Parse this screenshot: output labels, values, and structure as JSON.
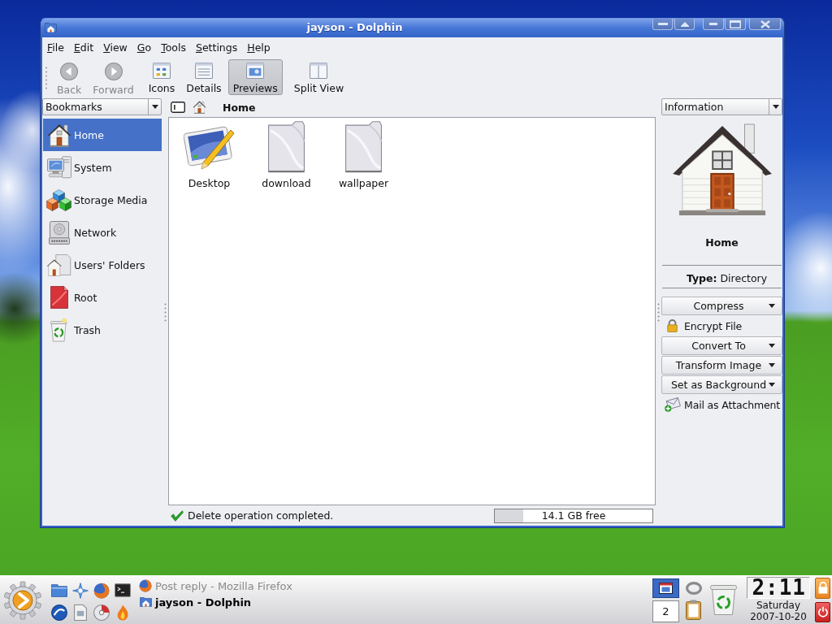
{
  "window": {
    "title": "jayson - Dolphin"
  },
  "menu_bar": [
    "File",
    "Edit",
    "View",
    "Go",
    "Tools",
    "Settings",
    "Help"
  ],
  "toolbar": {
    "navigation": [
      {
        "label": "Back",
        "kind": "back",
        "disabled": true
      },
      {
        "label": "Forward",
        "kind": "forward",
        "disabled": true
      }
    ],
    "view_modes": [
      {
        "label": "Icons",
        "kind": "icons",
        "selected": false
      },
      {
        "label": "Details",
        "kind": "details",
        "selected": false
      },
      {
        "label": "Previews",
        "kind": "previews",
        "selected": true
      }
    ],
    "split_view": {
      "label": "Split View",
      "on": false
    }
  },
  "places_panel": {
    "selector": "Bookmarks",
    "items": [
      {
        "label": "Home",
        "kind": "home",
        "selected": true
      },
      {
        "label": "System",
        "kind": "system",
        "selected": false
      },
      {
        "label": "Storage Media",
        "kind": "storage",
        "selected": false
      },
      {
        "label": "Network",
        "kind": "network",
        "selected": false
      },
      {
        "label": "Users' Folders",
        "kind": "users",
        "selected": false
      },
      {
        "label": "Root",
        "kind": "root",
        "selected": false
      },
      {
        "label": "Trash",
        "kind": "trash",
        "selected": false
      }
    ]
  },
  "location_bar": {
    "path": "Home"
  },
  "files": [
    {
      "name": "Desktop",
      "kind": "desktop"
    },
    {
      "name": "download",
      "kind": "folder"
    },
    {
      "name": "wallpaper",
      "kind": "folder"
    }
  ],
  "info_panel": {
    "selector": "Information",
    "name": "Home",
    "type_line": "**Type:** Directory",
    "actions": [
      {
        "label": "Compress",
        "kind": "menu"
      },
      {
        "label": "Encrypt File",
        "kind": "lock"
      },
      {
        "label": "Convert To",
        "kind": "menu"
      },
      {
        "label": "Transform Image",
        "kind": "menu"
      },
      {
        "label": "Set as Background",
        "kind": "menu"
      },
      {
        "label": "Mail as Attachment",
        "kind": "mail"
      }
    ]
  },
  "status_bar": {
    "message": "Delete operation completed.",
    "free_space": {
      "reading": "14.1 GB free",
      "level": 0.18
    }
  },
  "taskbar": {
    "tasks": [
      {
        "title": "Post reply - Mozilla Firefox",
        "kind": "browser",
        "selected": false
      },
      {
        "title": "jayson - Dolphin",
        "kind": "file-manager",
        "selected": true
      }
    ],
    "pager": [
      {
        "kind": "thumbnail",
        "selected": true
      },
      {
        "kind": "number",
        "label": "2",
        "selected": false
      }
    ],
    "clock": {
      "time": "2:11",
      "day": "Saturday",
      "date": "2007-10-20"
    }
  }
}
